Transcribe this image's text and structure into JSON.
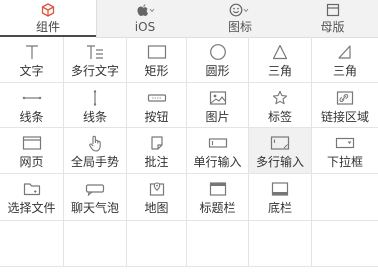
{
  "tabs": [
    {
      "label": "组件",
      "icon": "cube-icon",
      "active": true
    },
    {
      "label": "iOS",
      "icon": "apple-icon",
      "dropdown": true
    },
    {
      "label": "图标",
      "icon": "smiley-icon",
      "dropdown": true
    },
    {
      "label": "母版",
      "icon": "stack-icon"
    }
  ],
  "components": [
    {
      "label": "文字",
      "icon": "text-icon"
    },
    {
      "label": "多行文字",
      "icon": "multiline-text-icon"
    },
    {
      "label": "矩形",
      "icon": "rectangle-icon"
    },
    {
      "label": "圆形",
      "icon": "circle-icon"
    },
    {
      "label": "三角",
      "icon": "triangle-icon"
    },
    {
      "label": "三角",
      "icon": "right-triangle-icon"
    },
    {
      "label": "线条",
      "icon": "horizontal-line-icon"
    },
    {
      "label": "线条",
      "icon": "vertical-line-icon"
    },
    {
      "label": "按钮",
      "icon": "button-icon"
    },
    {
      "label": "图片",
      "icon": "image-icon"
    },
    {
      "label": "标签",
      "icon": "star-icon"
    },
    {
      "label": "链接区域",
      "icon": "link-icon"
    },
    {
      "label": "网页",
      "icon": "webpage-icon"
    },
    {
      "label": "全局手势",
      "icon": "hand-icon"
    },
    {
      "label": "批注",
      "icon": "annotation-icon"
    },
    {
      "label": "单行输入",
      "icon": "single-input-icon"
    },
    {
      "label": "多行输入",
      "icon": "multi-input-icon"
    },
    {
      "label": "下拉框",
      "icon": "dropdown-icon"
    },
    {
      "label": "选择文件",
      "icon": "folder-icon"
    },
    {
      "label": "聊天气泡",
      "icon": "chat-bubble-icon"
    },
    {
      "label": "地图",
      "icon": "map-icon"
    },
    {
      "label": "标题栏",
      "icon": "title-bar-icon"
    },
    {
      "label": "底栏",
      "icon": "bottom-bar-icon"
    }
  ]
}
